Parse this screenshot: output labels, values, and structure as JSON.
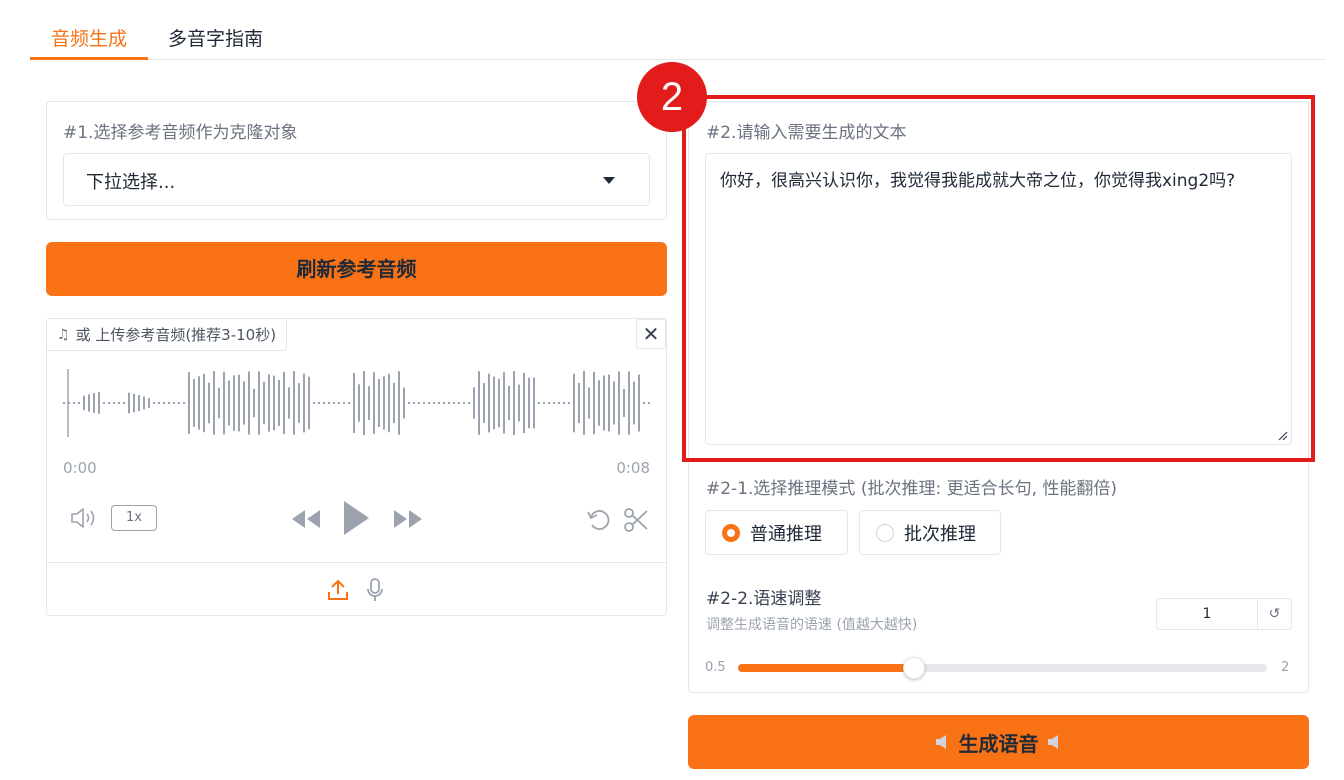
{
  "tabs": [
    {
      "label": "音频生成",
      "active": true
    },
    {
      "label": "多音字指南",
      "active": false
    }
  ],
  "reference": {
    "label": "#1.选择参考音频作为克隆对象",
    "select_value": "下拉选择...",
    "refresh_button": "刷新参考音频"
  },
  "audio": {
    "upload_label": "或 上传参考音频(推荐3-10秒)",
    "time_start": "0:00",
    "time_end": "0:08",
    "playback_speed": "1x"
  },
  "text_input": {
    "label": "#2.请输入需要生成的文本",
    "value": "你好，很高兴认识你，我觉得我能成就大帝之位，你觉得我xing2吗?"
  },
  "annotation": {
    "badge": "2",
    "color": "#e21b1b"
  },
  "inference": {
    "label": "#2-1.选择推理模式 (批次推理: 更适合长句, 性能翻倍)",
    "options": [
      {
        "label": "普通推理",
        "selected": true
      },
      {
        "label": "批次推理",
        "selected": false
      }
    ]
  },
  "speed": {
    "label": "#2-2.语速调整",
    "hint": "调整生成语音的语速 (值越大越快)",
    "value": "1",
    "min": "0.5",
    "max": "2",
    "level": 1
  },
  "generate_button": "生成语音",
  "colors": {
    "accent": "#f97316",
    "text": "#1f2937",
    "muted": "#6b7280"
  }
}
